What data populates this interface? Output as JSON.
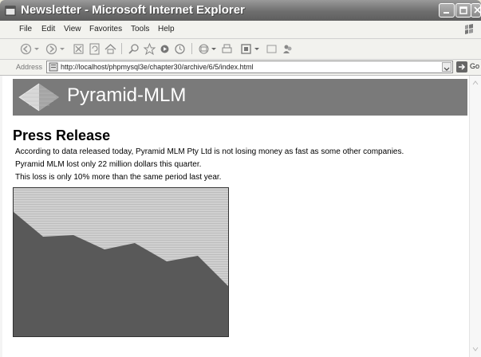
{
  "window": {
    "title": "Newsletter - Microsoft Internet Explorer",
    "controls": [
      "minimize-icon",
      "maximize-icon",
      "close-icon"
    ]
  },
  "menu": {
    "items": [
      "File",
      "Edit",
      "View",
      "Favorites",
      "Tools",
      "Help"
    ]
  },
  "toolbar": {
    "icons": [
      "back-icon",
      "forward-icon",
      "stop-icon",
      "refresh-icon",
      "home-icon",
      "search-icon",
      "favorites-icon",
      "media-icon",
      "history-icon",
      "mail-icon",
      "print-icon",
      "edit-icon",
      "discuss-icon",
      "messenger-icon"
    ]
  },
  "address": {
    "label": "Address",
    "url": "http://localhost/phpmysql3e/chapter30/archive/6/5/index.html",
    "go_label": "Go"
  },
  "page": {
    "banner_title": "Pyramid-MLM",
    "heading": "Press Release",
    "paragraphs": [
      "According to data released today, Pyramid MLM Pty Ltd is not losing money as fast as some other companies.",
      "Pyramid MLM lost only 22 million dollars this quarter.",
      "This loss is only 10% more than the same period last year."
    ]
  },
  "colors": {
    "banner": "#7a7a7a",
    "chart_area": "#5a5a5a",
    "chart_bg": "#c9c9c9"
  }
}
